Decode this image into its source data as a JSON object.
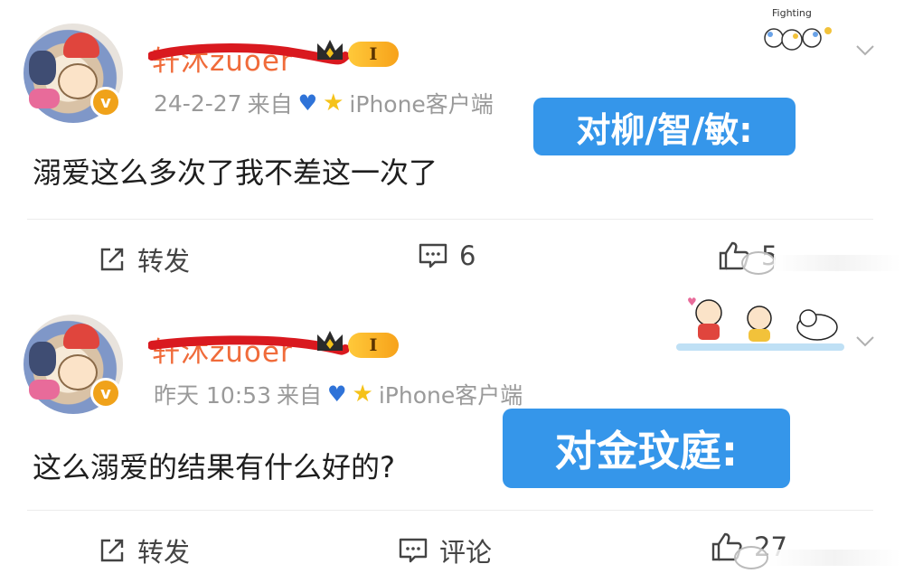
{
  "posts": [
    {
      "username": "轩沐zuoer",
      "level": "I",
      "meta": {
        "time": "24-2-27",
        "source_prefix": "来自",
        "source_client": "iPhone客户端"
      },
      "content": "溺爱这么多次了我不差这一次了",
      "tag": "对柳/智/敏:",
      "sticker_text": "Fighting",
      "actions": {
        "repost": "转发",
        "comment": "6",
        "like": "5"
      }
    },
    {
      "username": "轩沐zuoer",
      "level": "I",
      "meta": {
        "time": "昨天 10:53",
        "source_prefix": "来自",
        "source_client": "iPhone客户端"
      },
      "content": "这么溺爱的结果有什么好的?",
      "tag": "对金玟庭:",
      "actions": {
        "repost": "转发",
        "comment": "评论",
        "like": "27"
      }
    }
  ],
  "colors": {
    "tag_bg": "#3596ea",
    "username": "#f06b3a",
    "redaction": "#d9191f",
    "badge": "#f7a21a"
  },
  "icons": [
    "share-icon",
    "comment-icon",
    "thumbs-up-icon",
    "crown-icon",
    "heart-icon",
    "star-icon",
    "chevron-down-icon",
    "verified-v-icon"
  ]
}
